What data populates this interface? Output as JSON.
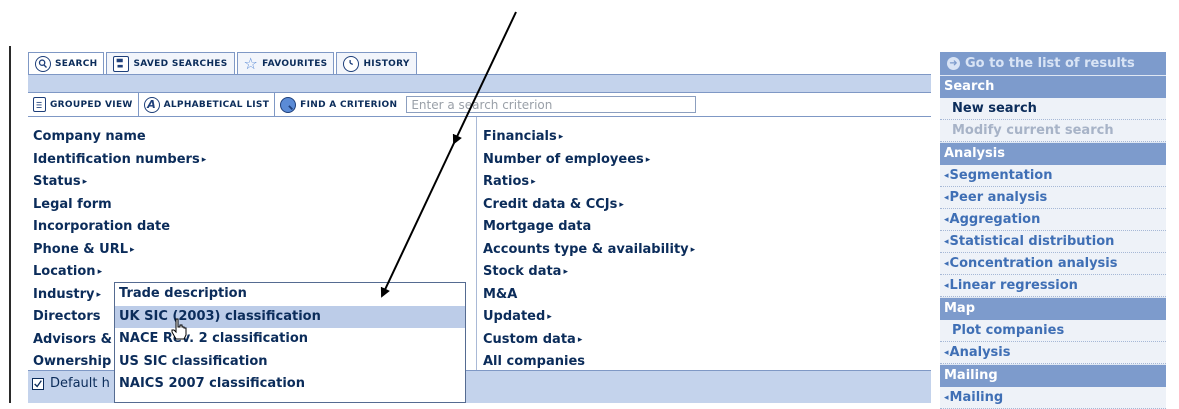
{
  "tabs": [
    {
      "label": "SEARCH",
      "icon": "search-icon"
    },
    {
      "label": "SAVED SEARCHES",
      "icon": "floppy-disk-icon"
    },
    {
      "label": "FAVOURITES",
      "icon": "star-icon"
    },
    {
      "label": "HISTORY",
      "icon": "history-icon"
    }
  ],
  "toolbar": {
    "grouped_view": "GROUPED VIEW",
    "alphabetical_list": "ALPHABETICAL LIST",
    "find_criterion": "FIND A CRITERION",
    "search_placeholder": "Enter a search criterion"
  },
  "left_criteria": [
    {
      "label": "Company name",
      "arrow": ""
    },
    {
      "label": "Identification numbers",
      "arrow": "▸"
    },
    {
      "label": "Status",
      "arrow": "▸"
    },
    {
      "label": "Legal form",
      "arrow": ""
    },
    {
      "label": "Incorporation date",
      "arrow": ""
    },
    {
      "label": "Phone & URL",
      "arrow": "▸"
    },
    {
      "label": "Location",
      "arrow": "▸"
    },
    {
      "label": "Industry",
      "arrow": "▸"
    },
    {
      "label": "Directors",
      "arrow": ""
    },
    {
      "label": "Advisors &",
      "arrow": ""
    },
    {
      "label": "Ownership",
      "arrow": ""
    }
  ],
  "right_criteria": [
    {
      "label": "Financials",
      "arrow": "▸"
    },
    {
      "label": "Number of employees",
      "arrow": "▸"
    },
    {
      "label": "Ratios",
      "arrow": "▸"
    },
    {
      "label": "Credit data & CCJs",
      "arrow": "▸"
    },
    {
      "label": "Mortgage data",
      "arrow": ""
    },
    {
      "label": "Accounts type & availability",
      "arrow": "▸"
    },
    {
      "label": "Stock data",
      "arrow": "▸"
    },
    {
      "label": "M&A",
      "arrow": ""
    },
    {
      "label": "Updated",
      "arrow": "▸"
    },
    {
      "label": "Custom data",
      "arrow": "▸"
    },
    {
      "label": "All companies",
      "arrow": ""
    }
  ],
  "industry_submenu": [
    "Trade description",
    "UK SIC (2003) classification",
    "NACE Rev. 2 classification",
    "US SIC classification",
    "NAICS 2007 classification"
  ],
  "footer": {
    "default_label": "Default h"
  },
  "sidebar": {
    "go_to_results": "Go to the list of results",
    "search_header": "Search",
    "new_search": "New search",
    "modify_search": "Modify current search",
    "analysis_header": "Analysis",
    "analysis_items": [
      "Segmentation",
      "Peer analysis",
      "Aggregation",
      "Statistical distribution",
      "Concentration analysis",
      "Linear regression"
    ],
    "map_header": "Map",
    "plot_companies": "Plot companies",
    "map_analysis": "Analysis",
    "mailing_header": "Mailing",
    "mailing_item": "Mailing"
  },
  "colors": {
    "accent": "#7d9bcc",
    "text": "#0b2c5a",
    "link": "#3f6fb5",
    "highlight": "#bccce8"
  }
}
